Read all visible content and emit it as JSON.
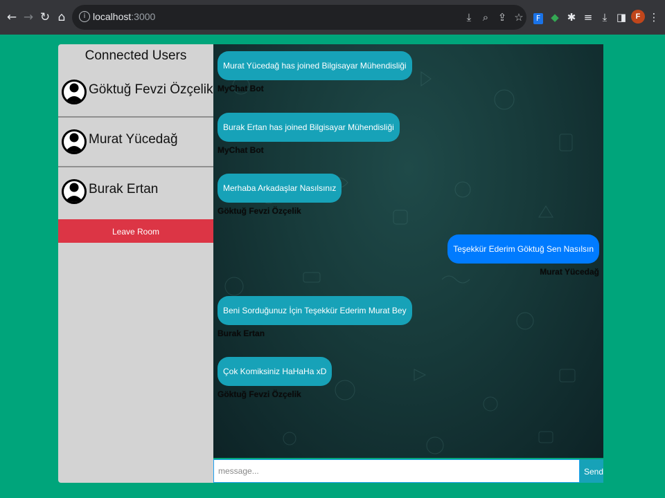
{
  "browser": {
    "url_host": "localhost",
    "url_port": ":3000",
    "profile_initial": "F",
    "profile_color": "#c0461b"
  },
  "sidebar": {
    "title": "Connected Users",
    "users": [
      {
        "name": "Göktuğ Fevzi Özçelik",
        "icon": "user-avatar-icon"
      },
      {
        "name": "Murat Yücedağ",
        "icon": "user-avatar-icon"
      },
      {
        "name": "Burak Ertan",
        "icon": "user-avatar-icon"
      }
    ],
    "leave_label": "Leave Room",
    "leave_color": "#dc3545"
  },
  "chat": {
    "messages": [
      {
        "text": "Murat Yücedağ has joined Bilgisayar Mühendisliği",
        "author": "MyChat Bot",
        "side": "left"
      },
      {
        "text": "Burak Ertan has joined Bilgisayar Mühendisliği",
        "author": "MyChat Bot",
        "side": "left"
      },
      {
        "text": "Merhaba Arkadaşlar Nasılsınız",
        "author": "Göktuğ Fevzi Özçelik",
        "side": "left"
      },
      {
        "text": "Teşekkür Ederim Göktuğ Sen Nasılsın",
        "author": "Murat Yücedağ",
        "side": "right"
      },
      {
        "text": "Beni Sorduğunuz İçin Teşekkür Ederim Murat Bey",
        "author": "Burak Ertan",
        "side": "left"
      },
      {
        "text": "Çok Komiksiniz HaHaHa xD",
        "author": "Göktuğ Fevzi Özçelik",
        "side": "left"
      }
    ],
    "incoming_color": "#17a2b8",
    "outgoing_color": "#007bff"
  },
  "composer": {
    "placeholder": "message...",
    "value": "",
    "send_label": "Send"
  },
  "background_color": "#00a57b"
}
